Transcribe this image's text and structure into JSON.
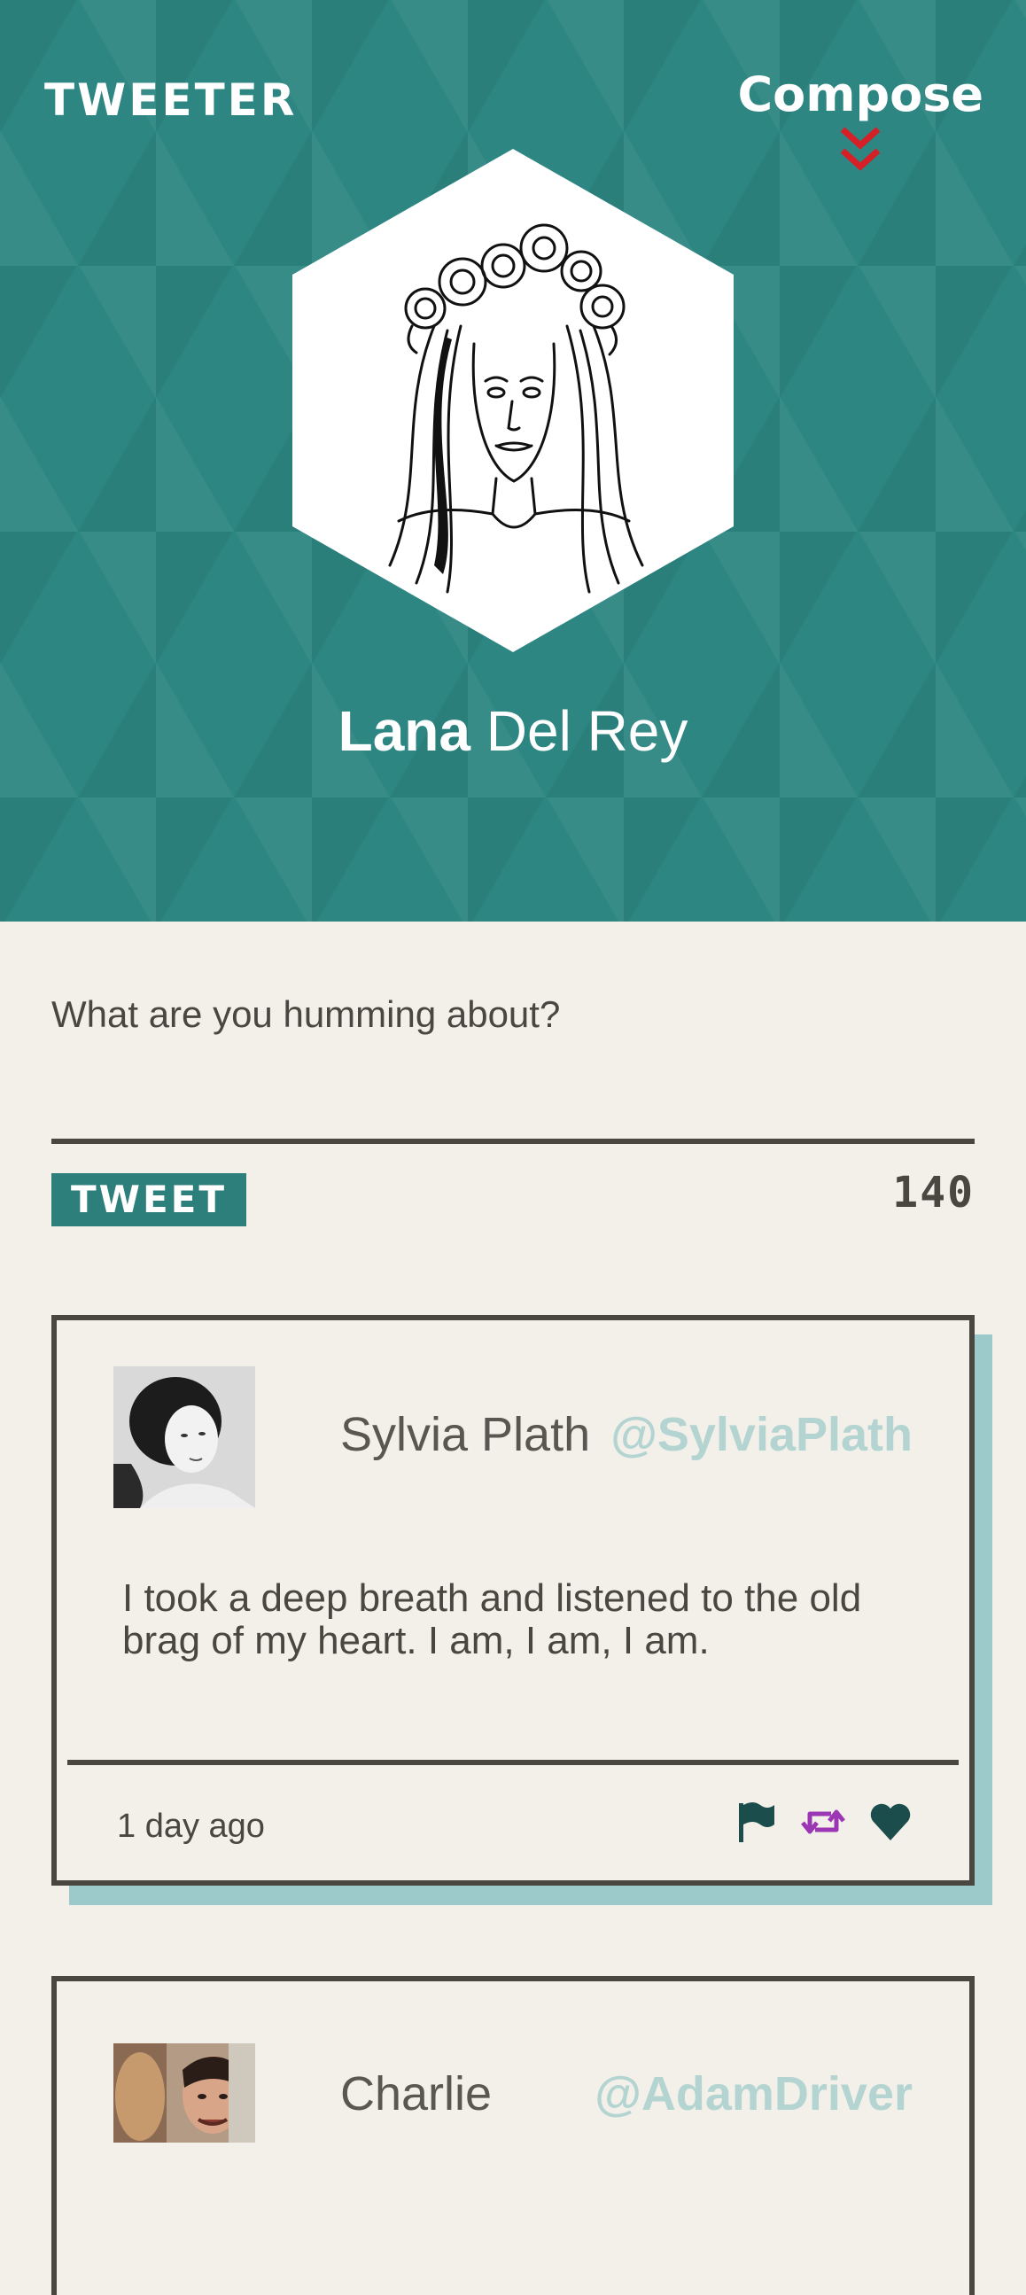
{
  "app": {
    "logo": "TWEETER",
    "compose_label": "Compose"
  },
  "profile": {
    "first_name": "Lana",
    "last_name": "Del Rey"
  },
  "composer": {
    "placeholder": "What are you humming about?",
    "tweet_button": "TWEET",
    "char_count": "140"
  },
  "tweets": [
    {
      "name": "Sylvia Plath",
      "handle": "@SylviaPlath",
      "text": "I took a deep breath and listened to the old brag of my heart. I am, I am, I am.",
      "time": "1 day ago",
      "actions": [
        "flag-icon",
        "retweet-icon",
        "heart-icon"
      ]
    },
    {
      "name": "Charlie",
      "handle": "@AdamDriver"
    }
  ],
  "colors": {
    "header_bg": "#2d8682",
    "page_bg": "#f3f0ea",
    "text": "#4a4640",
    "handle": "#b4d4d2",
    "card_shadow": "#9ccaca",
    "accent_red": "#d62027",
    "retweet": "#9b37b5",
    "flag_heart": "#1a4d4b"
  }
}
